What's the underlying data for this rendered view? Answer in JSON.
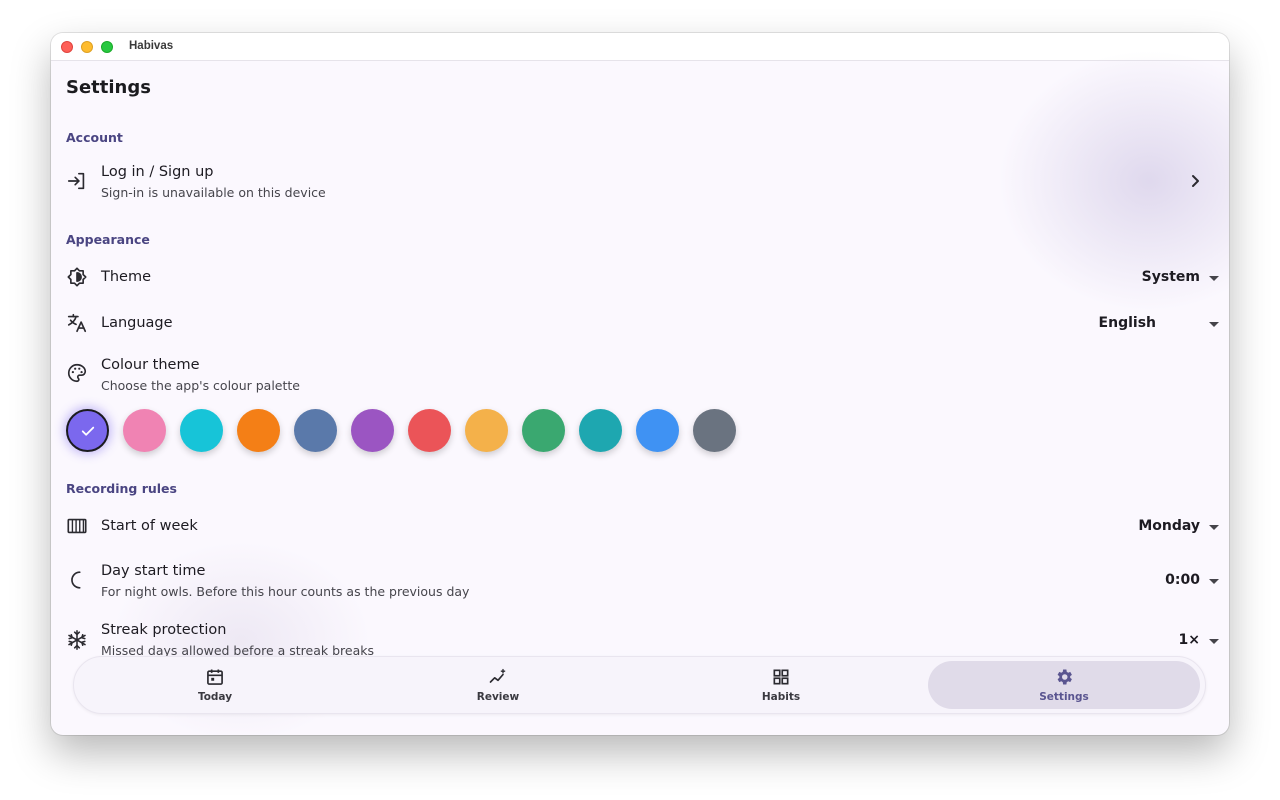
{
  "window": {
    "title": "Habivas"
  },
  "page": {
    "title": "Settings"
  },
  "sections": {
    "account": "Account",
    "appearance": "Appearance",
    "recording": "Recording rules"
  },
  "account": {
    "login": {
      "label": "Log in / Sign up",
      "sub": "Sign-in is unavailable on this device",
      "icon": "login-icon"
    }
  },
  "appearance": {
    "theme": {
      "label": "Theme",
      "value": "System",
      "icon": "theme-icon"
    },
    "language": {
      "label": "Language",
      "value": "English",
      "icon": "translate-icon"
    },
    "colour": {
      "label": "Colour theme",
      "sub": "Choose the app's colour palette",
      "icon": "palette-icon"
    },
    "swatches": [
      {
        "color": "#7b68ee",
        "selected": true
      },
      {
        "color": "#f083b3",
        "selected": false
      },
      {
        "color": "#17c4d8",
        "selected": false
      },
      {
        "color": "#f47f16",
        "selected": false
      },
      {
        "color": "#5a79aa",
        "selected": false
      },
      {
        "color": "#9b55c2",
        "selected": false
      },
      {
        "color": "#eb5458",
        "selected": false
      },
      {
        "color": "#f4b14a",
        "selected": false
      },
      {
        "color": "#3aa870",
        "selected": false
      },
      {
        "color": "#1ea7b0",
        "selected": false
      },
      {
        "color": "#3f92f3",
        "selected": false
      },
      {
        "color": "#6a7380",
        "selected": false
      }
    ]
  },
  "recording": {
    "week": {
      "label": "Start of week",
      "value": "Monday",
      "icon": "calendar-week-icon"
    },
    "daystart": {
      "label": "Day start time",
      "sub": "For night owls. Before this hour counts as the previous day",
      "value": "0:00",
      "icon": "moon-icon"
    },
    "streak": {
      "label": "Streak protection",
      "sub": "Missed days allowed before a streak breaks",
      "value": "1×",
      "icon": "snowflake-icon"
    }
  },
  "nav": {
    "today": "Today",
    "review": "Review",
    "habits": "Habits",
    "settings": "Settings"
  },
  "colors": {
    "accent": "#7b68ee",
    "nav_active_bg": "#e0dbe9",
    "section_text": "#4a4582"
  }
}
